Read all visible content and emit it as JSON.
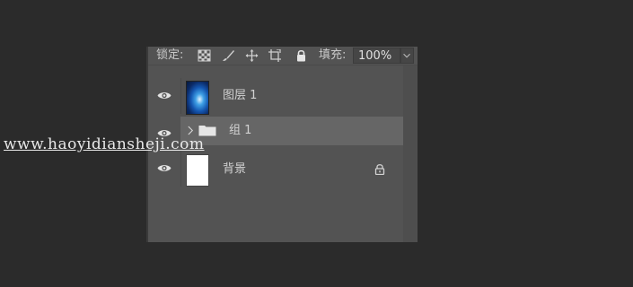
{
  "lock_bar": {
    "lock_label": "锁定:",
    "lock_icons": [
      "lock-transparent-pixels-icon",
      "lock-image-pixels-icon",
      "lock-position-icon",
      "lock-artboard-icon",
      "lock-all-icon"
    ],
    "fill_label": "填充:",
    "fill_value": "100%"
  },
  "layers": [
    {
      "name": "图层 1",
      "visible": true,
      "thumbnail": "blue-swirl-image"
    },
    {
      "name": "组 1",
      "visible": true,
      "type": "group",
      "selected": true
    },
    {
      "name": "背景",
      "visible": true,
      "locked": true,
      "thumbnail": "white"
    }
  ],
  "watermark": "www.haoyidiansheji.com",
  "colors": {
    "app_bg": "#2b2b2b",
    "panel_bg": "#535353",
    "selected_row": "#666666",
    "text": "#d2d2d2"
  }
}
